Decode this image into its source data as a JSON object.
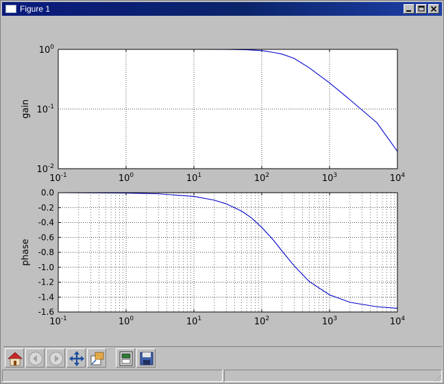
{
  "window": {
    "title": "Figure 1",
    "title_icon": "window-icon",
    "buttons": [
      "minimize",
      "maximize",
      "close"
    ]
  },
  "toolbar": {
    "buttons": [
      {
        "name": "home-button",
        "icon": "home-icon",
        "enabled": true
      },
      {
        "name": "back-button",
        "icon": "back-arrow-icon",
        "enabled": false
      },
      {
        "name": "forward-button",
        "icon": "forward-arrow-icon",
        "enabled": false
      },
      {
        "name": "pan-button",
        "icon": "pan-icon",
        "enabled": true
      },
      {
        "name": "zoom-button",
        "icon": "zoom-rect-icon",
        "enabled": true
      },
      {
        "name": "subplots-button",
        "icon": "subplots-icon",
        "enabled": true
      },
      {
        "name": "save-button",
        "icon": "save-icon",
        "enabled": true
      }
    ]
  },
  "statusbar": {
    "left": "",
    "right": ""
  },
  "colors": {
    "line": "#0000cc",
    "titlebar": "#0a246a",
    "face": "#c0c0c0"
  },
  "chart_data": [
    {
      "type": "line",
      "xscale": "log",
      "yscale": "log",
      "xlim": [
        0.1,
        10000
      ],
      "ylim": [
        0.01,
        1
      ],
      "xlabel": "",
      "ylabel": "gain",
      "grid": true,
      "xticks": [
        {
          "base": "10",
          "exp": "-1"
        },
        {
          "base": "10",
          "exp": "0"
        },
        {
          "base": "10",
          "exp": "1"
        },
        {
          "base": "10",
          "exp": "2"
        },
        {
          "base": "10",
          "exp": "3"
        },
        {
          "base": "10",
          "exp": "4"
        }
      ],
      "yticks": [
        {
          "base": "10",
          "exp": "0"
        },
        {
          "base": "10",
          "exp": "-1"
        },
        {
          "base": "10",
          "exp": "-2"
        }
      ],
      "x": [
        0.1,
        1,
        10,
        30,
        60,
        100,
        150,
        200,
        300,
        500,
        1000,
        2000,
        5000,
        10000
      ],
      "y": [
        1.0,
        1.0,
        1.0,
        0.999,
        0.986,
        0.954,
        0.888,
        0.832,
        0.707,
        0.492,
        0.274,
        0.143,
        0.0587,
        0.0195
      ]
    },
    {
      "type": "line",
      "xscale": "log",
      "yscale": "linear",
      "xlim": [
        0.1,
        10000
      ],
      "ylim": [
        -1.6,
        0.0
      ],
      "xlabel": "",
      "ylabel": "phase",
      "grid": true,
      "xticks": [
        {
          "base": "10",
          "exp": "-1"
        },
        {
          "base": "10",
          "exp": "0"
        },
        {
          "base": "10",
          "exp": "1"
        },
        {
          "base": "10",
          "exp": "2"
        },
        {
          "base": "10",
          "exp": "3"
        },
        {
          "base": "10",
          "exp": "4"
        }
      ],
      "yticks": [
        "0.0",
        "-0.2",
        "-0.4",
        "-0.6",
        "-0.8",
        "-1.0",
        "-1.2",
        "-1.4",
        "-1.6"
      ],
      "x": [
        0.1,
        1,
        3,
        10,
        20,
        30,
        50,
        70,
        100,
        150,
        200,
        300,
        500,
        1000,
        2000,
        5000,
        10000
      ],
      "y": [
        0.0,
        -0.005,
        -0.015,
        -0.05,
        -0.1,
        -0.15,
        -0.245,
        -0.335,
        -0.465,
        -0.64,
        -0.785,
        -0.98,
        -1.19,
        -1.37,
        -1.47,
        -1.53,
        -1.55
      ]
    }
  ]
}
